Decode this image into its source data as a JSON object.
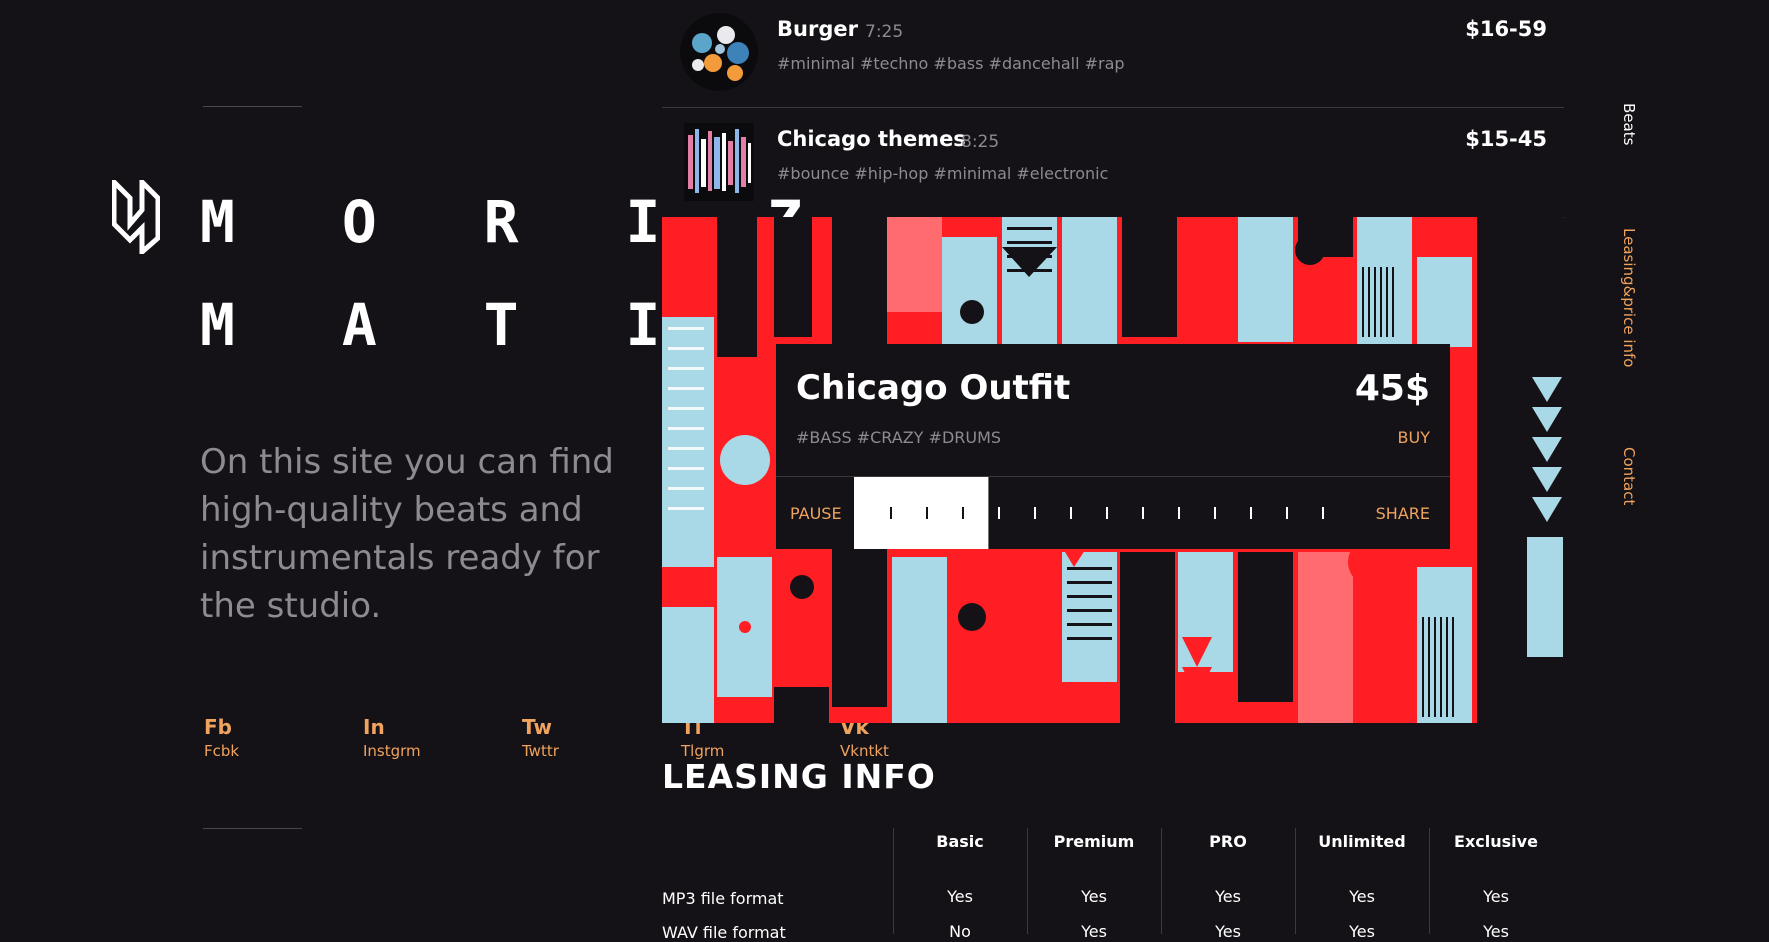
{
  "brand": {
    "line1": "M O R I Z",
    "line2": "M A T I K"
  },
  "tagline": "On this site you can find high-quality beats and instrumentals ready for the studio.",
  "socials": [
    {
      "abbr": "Fb",
      "name": "Fcbk"
    },
    {
      "abbr": "In",
      "name": "Instgrm"
    },
    {
      "abbr": "Tw",
      "name": "Twttr"
    },
    {
      "abbr": "Tl",
      "name": "Tlgrm"
    },
    {
      "abbr": "Vk",
      "name": "Vkntkt"
    }
  ],
  "tracks": [
    {
      "title": "Burger",
      "duration": "7:25",
      "tags": "#minimal #techno #bass #dancehall #rap",
      "price": "$16-59"
    },
    {
      "title": "Chicago themes",
      "duration": "8:25",
      "tags": "#bounce #hip-hop #minimal #electronic",
      "price": "$15-45"
    }
  ],
  "player": {
    "title": "Chicago Outfit",
    "price": "45$",
    "tags": "#BASS #CRAZY #DRUMS",
    "buy_label": "BUY",
    "pause_label": "PAUSE",
    "share_label": "SHARE",
    "progress": 0.28
  },
  "nav": {
    "beats": "Beats",
    "leasing": "Leasing&price info",
    "contact": "Contact"
  },
  "leasing": {
    "title": "LEASING INFO",
    "columns": [
      "Basic",
      "Premium",
      "PRO",
      "Unlimited",
      "Exclusive"
    ],
    "rows": [
      {
        "label": "MP3 file format",
        "values": [
          "Yes",
          "Yes",
          "Yes",
          "Yes",
          "Yes"
        ]
      },
      {
        "label": "WAV file format",
        "values": [
          "No",
          "Yes",
          "Yes",
          "Yes",
          "Yes"
        ]
      }
    ]
  },
  "colors": {
    "accent": "#f0a35e",
    "background": "#141216",
    "art_red": "#ff1e24",
    "art_blue": "#a9d9e6"
  }
}
